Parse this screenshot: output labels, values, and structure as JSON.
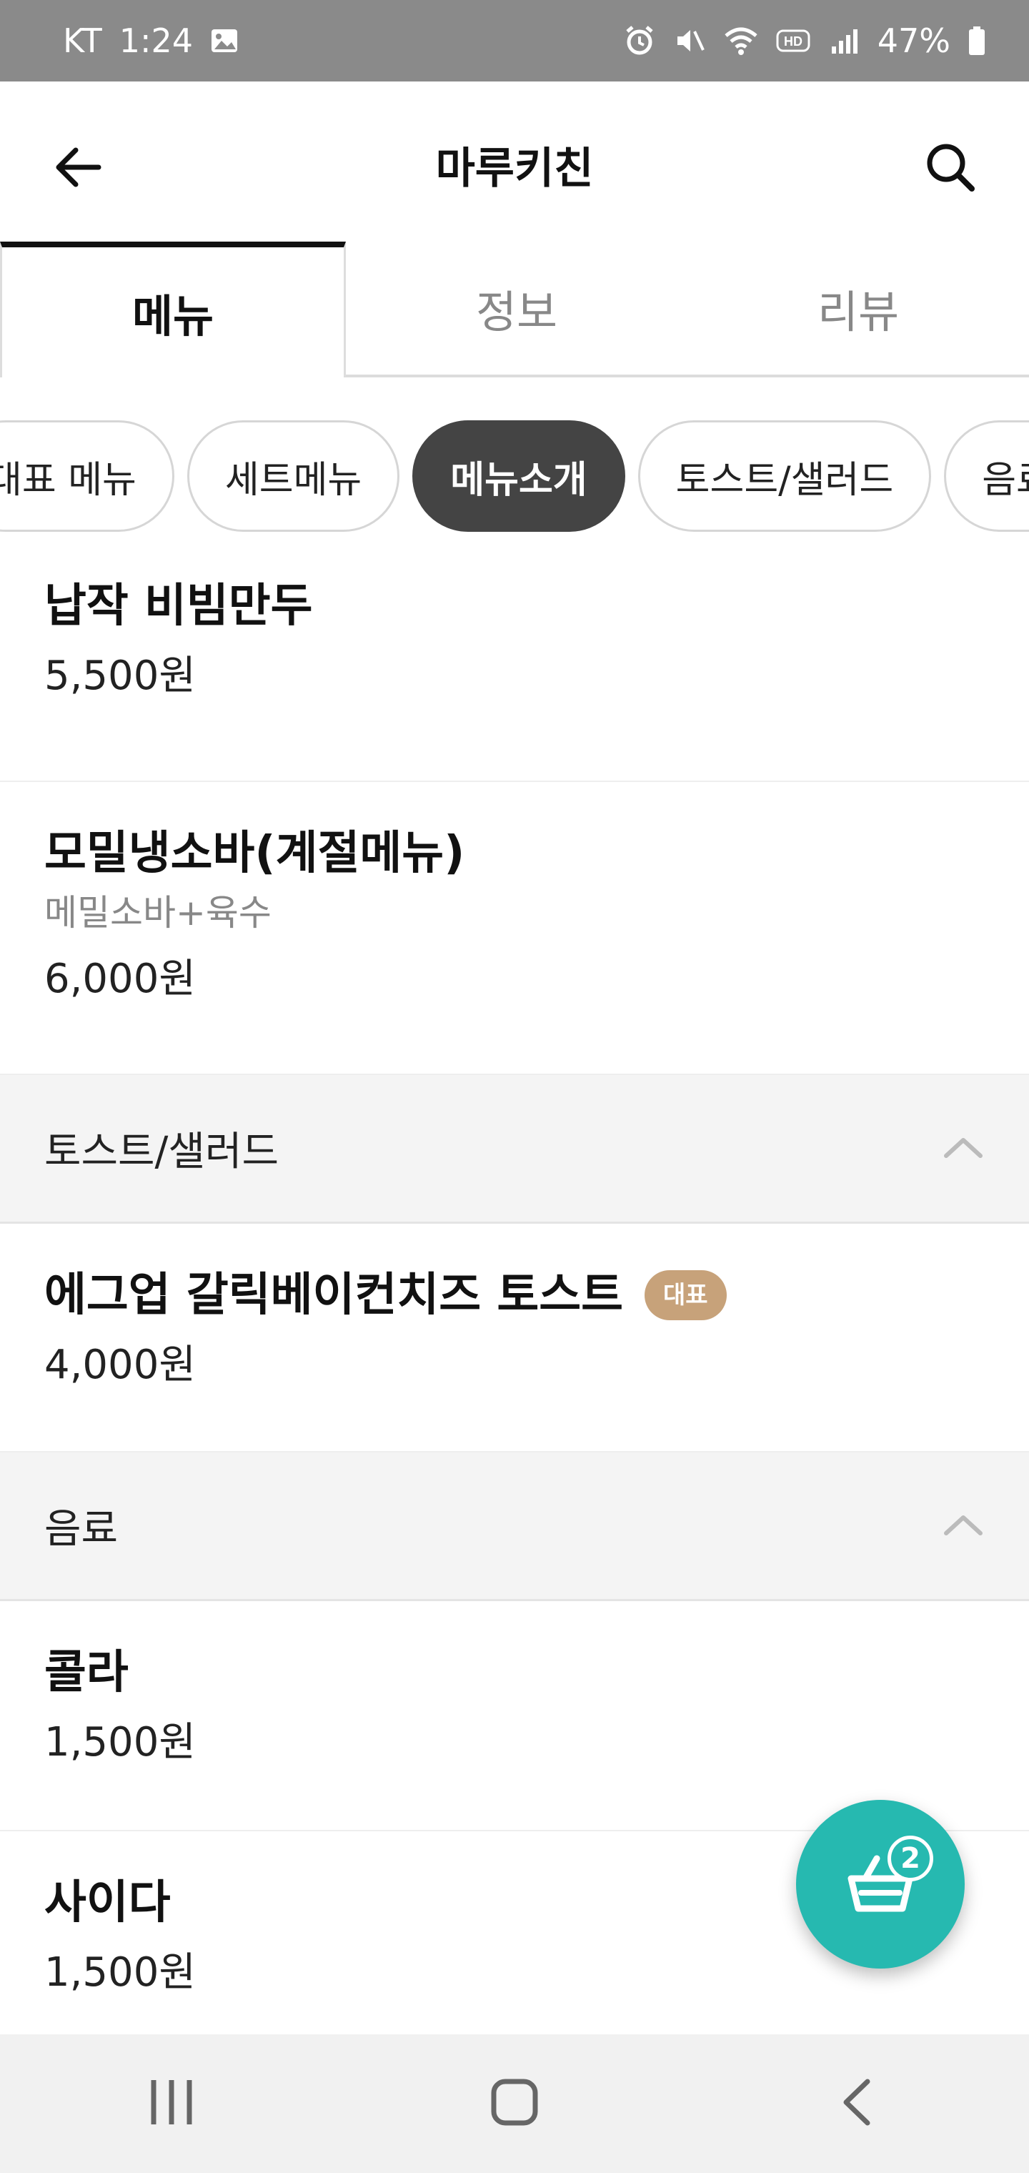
{
  "status_bar": {
    "carrier": "KT",
    "time": "1:24",
    "battery": "47%",
    "icons": [
      "image-icon",
      "alarm-icon",
      "mute-icon",
      "wifi-icon",
      "hd-icon",
      "signal-icon",
      "battery-icon"
    ]
  },
  "header": {
    "title": "마루키친",
    "back_icon": "arrow-left-icon",
    "search_icon": "search-icon"
  },
  "tabs": [
    {
      "label": "메뉴",
      "active": true
    },
    {
      "label": "정보",
      "active": false
    },
    {
      "label": "리뷰",
      "active": false
    }
  ],
  "chips": [
    {
      "label": "대표 메뉴",
      "active": false
    },
    {
      "label": "세트메뉴",
      "active": false
    },
    {
      "label": "메뉴소개",
      "active": true
    },
    {
      "label": "토스트/샐러드",
      "active": false
    },
    {
      "label": "음료",
      "active": false
    }
  ],
  "menu_items_top": [
    {
      "name": "납작 비빔만두",
      "price": "5,500원"
    },
    {
      "name": "모밀냉소바(계절메뉴)",
      "description": "메밀소바+육수",
      "price": "6,000원"
    }
  ],
  "sections": [
    {
      "title": "토스트/샐러드",
      "items": [
        {
          "name": "에그업 갈릭베이컨치즈 토스트",
          "badge": "대표",
          "price": "4,000원"
        }
      ]
    },
    {
      "title": "음료",
      "items": [
        {
          "name": "콜라",
          "price": "1,500원"
        },
        {
          "name": "사이다",
          "price": "1,500원"
        }
      ]
    }
  ],
  "cart": {
    "count": "2",
    "icon": "basket-icon"
  },
  "nav": {
    "icons": [
      "recent-apps-icon",
      "home-icon",
      "back-icon"
    ]
  },
  "colors": {
    "accent": "#26b9b0",
    "badge": "#c7a27a",
    "chip_active": "#444444"
  }
}
